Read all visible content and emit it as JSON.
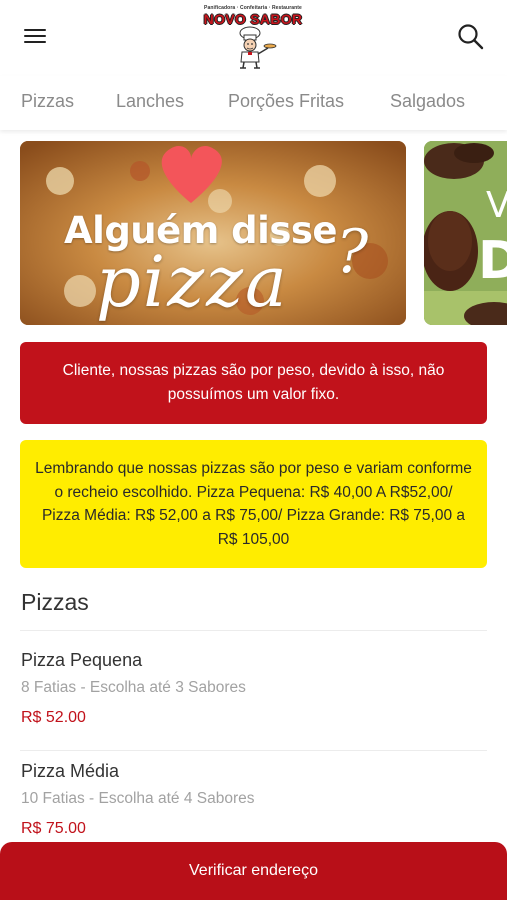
{
  "header": {
    "logo_tagline": "Panificadora · Confeitaria · Restaurante",
    "logo_name": "NOVO SABOR"
  },
  "tabs": [
    {
      "label": "Pizzas"
    },
    {
      "label": "Lanches"
    },
    {
      "label": "Porções Fritas"
    },
    {
      "label": "Salgados"
    }
  ],
  "banners": {
    "banner1": {
      "line1": "Alguém disse",
      "line2": "pizza",
      "mark": "?"
    },
    "banner2": {
      "line1": "V",
      "line2": "D"
    }
  },
  "notices": {
    "red": "Cliente, nossas pizzas são por peso, devido à isso, não possuímos um valor fixo.",
    "yellow": "Lembrando que nossas pizzas são por peso e variam conforme o recheio escolhido. Pizza Pequena: R$ 40,00 A R$52,00/ Pizza Média: R$ 52,00 a R$ 75,00/ Pizza Grande: R$ 75,00 a R$ 105,00"
  },
  "section": {
    "title": "Pizzas"
  },
  "products": [
    {
      "name": "Pizza Pequena",
      "description": "8 Fatias - Escolha até 3 Sabores",
      "price": "R$ 52.00"
    },
    {
      "name": "Pizza Média",
      "description": "10 Fatias - Escolha até 4 Sabores",
      "price": "R$ 75.00"
    }
  ],
  "cta": {
    "label": "Verificar endereço"
  },
  "colors": {
    "brand_red": "#c1121b",
    "notice_yellow": "#ffed00",
    "tab_text": "#8a8a8a"
  }
}
